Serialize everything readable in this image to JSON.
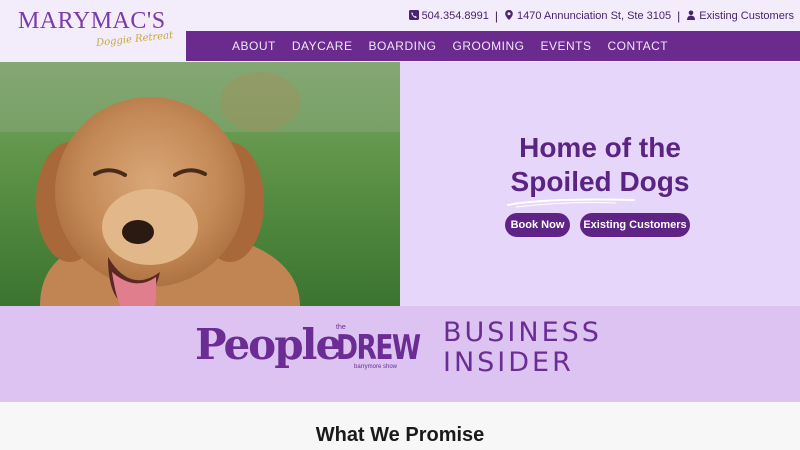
{
  "logo": {
    "main": "MARYMAC'S",
    "sub": "Doggie Retreat"
  },
  "topbar": {
    "phone": "504.354.8991",
    "address": "1470 Annunciation St, Ste 3105",
    "existing_customers": "Existing Customers",
    "separator": "|"
  },
  "nav": {
    "items": [
      {
        "label": "ABOUT"
      },
      {
        "label": "DAYCARE"
      },
      {
        "label": "BOARDING"
      },
      {
        "label": "GROOMING"
      },
      {
        "label": "EVENTS"
      },
      {
        "label": "CONTACT"
      }
    ]
  },
  "hero": {
    "title_line1": "Home of the",
    "title_line2": "Spoiled Dogs",
    "book_now": "Book Now",
    "existing_customers": "Existing Customers"
  },
  "press": {
    "people": "People",
    "drew_the": "the",
    "drew_main": "DREW",
    "drew_sub": "barrymore show",
    "bi_line1": "BUSINESS",
    "bi_line2": "INSIDER"
  },
  "promise": {
    "title": "What We Promise"
  },
  "colors": {
    "brand_purple": "#6a2a8e",
    "button_purple": "#5e2384",
    "hero_bg": "#e6d6fa",
    "press_bg": "#dcc3f2",
    "header_bg": "#f3ecfb"
  }
}
